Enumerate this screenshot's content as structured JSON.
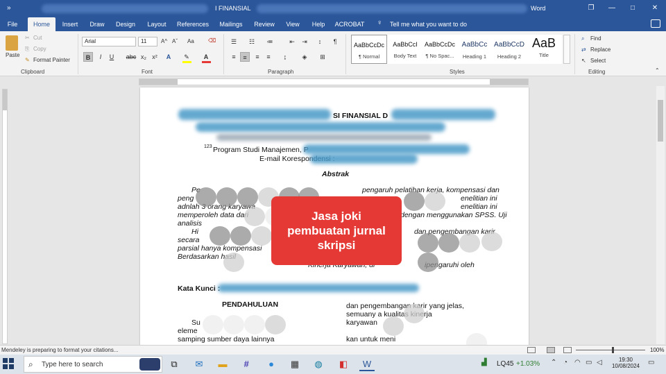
{
  "titlebar": {
    "qat_symbol": "»",
    "doc_title": "I FINANSIAL",
    "app_name": "Word",
    "restore_symbol": "❐",
    "minimize_symbol": "—",
    "maximize_symbol": "□",
    "close_symbol": "✕"
  },
  "tabs": [
    "File",
    "Home",
    "Insert",
    "Draw",
    "Design",
    "Layout",
    "References",
    "Mailings",
    "Review",
    "View",
    "Help",
    "ACROBAT"
  ],
  "active_tab": "Home",
  "tell_me": "Tell me what you want to do",
  "clipboard": {
    "paste": "Paste",
    "cut": "Cut",
    "copy": "Copy",
    "format_painter": "Format Painter",
    "label": "Clipboard"
  },
  "font": {
    "name": "Arial",
    "size": "11",
    "label": "Font",
    "grow": "A^",
    "shrink": "Aˇ",
    "case": "Aa",
    "bold": "B",
    "italic": "I",
    "underline": "U",
    "strike": "abc",
    "sub": "x₂",
    "sup": "x²"
  },
  "paragraph": {
    "label": "Paragraph",
    "pilcrow": "¶"
  },
  "styles": {
    "label": "Styles",
    "items": [
      {
        "preview": "AaBbCcDc",
        "name": "¶ Normal"
      },
      {
        "preview": "AaBbCcI",
        "name": "Body Text"
      },
      {
        "preview": "AaBbCcDc",
        "name": "¶ No Spac..."
      },
      {
        "preview": "AaBbCc",
        "name": "Heading 1"
      },
      {
        "preview": "AaBbCcD",
        "name": "Heading 2"
      },
      {
        "preview": "AaB",
        "name": "Title"
      }
    ]
  },
  "editing": {
    "find": "Find",
    "replace": "Replace",
    "select": "Select",
    "label": "Editing"
  },
  "document": {
    "heading_fragment": "SI FINANSIAL D",
    "affiliation": "Program Studi Manajemen, P",
    "affiliation_sup": "123",
    "email": "E-mail Korespondensi :",
    "abstract_title": "Abstrak",
    "abstract_lines": [
      "pengaruh pelatihan kerja, kompensasi dan",
      "peng",
      "adnlah 3 orang karyawa",
      "memperoleh data dari",
      "analisis"
    ],
    "abstract_right_fragments": [
      "enelitian ini",
      "enelitian ini",
      "dengan menggunakan SPSS. Uji",
      "dan pengembangan karir",
      "ipengaruhi oleh"
    ],
    "abstract_left_fragments": [
      "Pe",
      "secara",
      "parsial hanya kompensasi",
      "Berdasarkan hasil",
      "Hi"
    ],
    "abstract_kinerja": "Kinerja Karyawan, di",
    "keywords_label": "Kata Kunci :",
    "section_heading": "PENDAHULUAN",
    "right_col": [
      "dan pengembangan karir yang jelas,",
      "semuany        a kualitas kinerja",
      "karyawan",
      "kan untuk meni"
    ],
    "left_col": [
      "Su",
      "eleme",
      "samping sumber daya lainnya"
    ]
  },
  "overlay": {
    "line1": "Jasa joki",
    "line2": "pembuatan jurnal",
    "line3": "skripsi"
  },
  "status": {
    "message": "Mendeley is preparing to format your citations...",
    "zoom": "100%"
  },
  "taskbar": {
    "search_placeholder": "Type here to search",
    "stock_name": "LQ45",
    "stock_change": "+1.03%",
    "time": "19:30",
    "date": "10/08/2024"
  }
}
